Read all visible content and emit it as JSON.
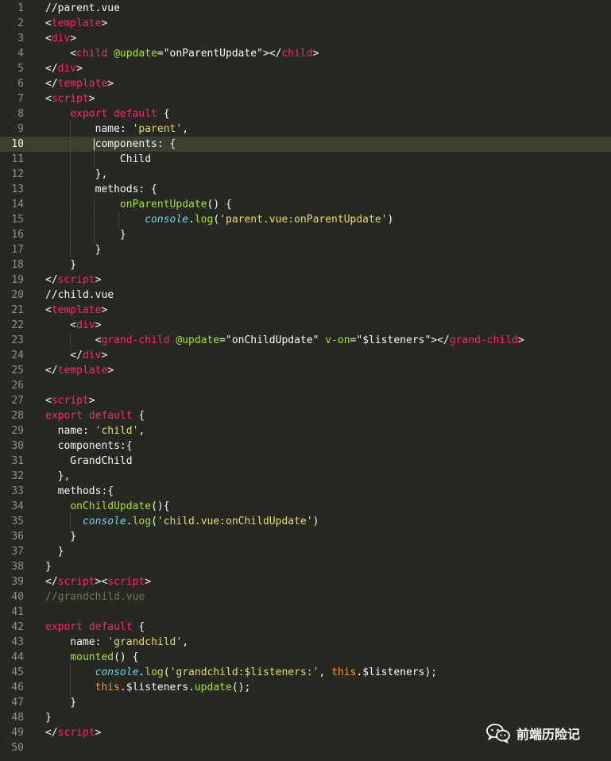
{
  "editor": {
    "active_line": 10,
    "lines": [
      {
        "n": "1",
        "t": [
          [
            "//parent.vue",
            "p"
          ]
        ]
      },
      {
        "n": "2",
        "t": [
          [
            "<",
            "p"
          ],
          [
            "template",
            "tag"
          ],
          [
            ">",
            "p"
          ]
        ]
      },
      {
        "n": "3",
        "t": [
          [
            "<",
            "p"
          ],
          [
            "div",
            "tag"
          ],
          [
            ">",
            "p"
          ]
        ]
      },
      {
        "n": "4",
        "t": [
          [
            "    <",
            "p"
          ],
          [
            "child",
            "tag"
          ],
          [
            " ",
            "p"
          ],
          [
            "@update",
            "attr"
          ],
          [
            "=",
            "p"
          ],
          [
            "\"onParentUpdate\"",
            "p"
          ],
          [
            "></",
            "p"
          ],
          [
            "child",
            "tag"
          ],
          [
            ">",
            "p"
          ]
        ]
      },
      {
        "n": "5",
        "t": [
          [
            "</",
            "p"
          ],
          [
            "div",
            "tag"
          ],
          [
            ">",
            "p"
          ]
        ]
      },
      {
        "n": "6",
        "t": [
          [
            "</",
            "p"
          ],
          [
            "template",
            "tag"
          ],
          [
            ">",
            "p"
          ]
        ]
      },
      {
        "n": "7",
        "t": [
          [
            "<",
            "p"
          ],
          [
            "script",
            "tag"
          ],
          [
            ">",
            "p"
          ]
        ]
      },
      {
        "n": "8",
        "t": [
          [
            "    ",
            "p"
          ],
          [
            "export default",
            "kw"
          ],
          [
            " {",
            "p"
          ]
        ]
      },
      {
        "n": "9",
        "t": [
          [
            "        name: ",
            "p"
          ],
          [
            "'parent'",
            "str"
          ],
          [
            ",",
            "p"
          ]
        ]
      },
      {
        "n": "10",
        "t": [
          [
            "        components: {",
            "p"
          ]
        ]
      },
      {
        "n": "11",
        "t": [
          [
            "            Child",
            "p"
          ]
        ]
      },
      {
        "n": "12",
        "t": [
          [
            "        },",
            "p"
          ]
        ]
      },
      {
        "n": "13",
        "t": [
          [
            "        methods: {",
            "p"
          ]
        ]
      },
      {
        "n": "14",
        "t": [
          [
            "            ",
            "p"
          ],
          [
            "onParentUpdate",
            "fn"
          ],
          [
            "() {",
            "p"
          ]
        ]
      },
      {
        "n": "15",
        "t": [
          [
            "                ",
            "p"
          ],
          [
            "console",
            "type"
          ],
          [
            ".",
            "p"
          ],
          [
            "log",
            "fn"
          ],
          [
            "(",
            "p"
          ],
          [
            "'parent.vue:onParentUpdate'",
            "str"
          ],
          [
            ")",
            "p"
          ]
        ]
      },
      {
        "n": "16",
        "t": [
          [
            "            }",
            "p"
          ]
        ]
      },
      {
        "n": "17",
        "t": [
          [
            "        }",
            "p"
          ]
        ]
      },
      {
        "n": "18",
        "t": [
          [
            "    }",
            "p"
          ]
        ]
      },
      {
        "n": "19",
        "t": [
          [
            "</",
            "p"
          ],
          [
            "script",
            "tag"
          ],
          [
            ">",
            "p"
          ]
        ]
      },
      {
        "n": "20",
        "t": [
          [
            "//child.vue",
            "p"
          ]
        ]
      },
      {
        "n": "21",
        "t": [
          [
            "<",
            "p"
          ],
          [
            "template",
            "tag"
          ],
          [
            ">",
            "p"
          ]
        ]
      },
      {
        "n": "22",
        "t": [
          [
            "    <",
            "p"
          ],
          [
            "div",
            "tag"
          ],
          [
            ">",
            "p"
          ]
        ]
      },
      {
        "n": "23",
        "t": [
          [
            "        <",
            "p"
          ],
          [
            "grand-child",
            "tag"
          ],
          [
            " ",
            "p"
          ],
          [
            "@update",
            "attr"
          ],
          [
            "=",
            "p"
          ],
          [
            "\"onChildUpdate\"",
            "p"
          ],
          [
            " ",
            "p"
          ],
          [
            "v-on",
            "attr"
          ],
          [
            "=",
            "p"
          ],
          [
            "\"$listeners\"",
            "p"
          ],
          [
            "></",
            "p"
          ],
          [
            "grand-child",
            "tag"
          ],
          [
            ">",
            "p"
          ]
        ]
      },
      {
        "n": "24",
        "t": [
          [
            "    </",
            "p"
          ],
          [
            "div",
            "tag"
          ],
          [
            ">",
            "p"
          ]
        ]
      },
      {
        "n": "25",
        "t": [
          [
            "</",
            "p"
          ],
          [
            "template",
            "tag"
          ],
          [
            ">",
            "p"
          ]
        ]
      },
      {
        "n": "26",
        "t": []
      },
      {
        "n": "27",
        "t": [
          [
            "<",
            "p"
          ],
          [
            "script",
            "tag"
          ],
          [
            ">",
            "p"
          ]
        ]
      },
      {
        "n": "28",
        "t": [
          [
            "export default",
            "kw"
          ],
          [
            " {",
            "p"
          ]
        ]
      },
      {
        "n": "29",
        "t": [
          [
            "  name: ",
            "p"
          ],
          [
            "'child'",
            "str"
          ],
          [
            ",",
            "p"
          ]
        ]
      },
      {
        "n": "30",
        "t": [
          [
            "  components:{",
            "p"
          ]
        ]
      },
      {
        "n": "31",
        "t": [
          [
            "    GrandChild",
            "p"
          ]
        ]
      },
      {
        "n": "32",
        "t": [
          [
            "  },",
            "p"
          ]
        ]
      },
      {
        "n": "33",
        "t": [
          [
            "  methods:{",
            "p"
          ]
        ]
      },
      {
        "n": "34",
        "t": [
          [
            "    ",
            "p"
          ],
          [
            "onChildUpdate",
            "fn"
          ],
          [
            "(){",
            "p"
          ]
        ]
      },
      {
        "n": "35",
        "t": [
          [
            "      ",
            "p"
          ],
          [
            "console",
            "type"
          ],
          [
            ".",
            "p"
          ],
          [
            "log",
            "fn"
          ],
          [
            "(",
            "p"
          ],
          [
            "'child.vue:onChildUpdate'",
            "str"
          ],
          [
            ")",
            "p"
          ]
        ]
      },
      {
        "n": "36",
        "t": [
          [
            "    }",
            "p"
          ]
        ]
      },
      {
        "n": "37",
        "t": [
          [
            "  }",
            "p"
          ]
        ]
      },
      {
        "n": "38",
        "t": [
          [
            "}",
            "p"
          ]
        ]
      },
      {
        "n": "39",
        "t": [
          [
            "</",
            "p"
          ],
          [
            "script",
            "tag"
          ],
          [
            "><",
            "p"
          ],
          [
            "script",
            "tag"
          ],
          [
            ">",
            "p"
          ]
        ]
      },
      {
        "n": "40",
        "t": [
          [
            "//grandchild.vue",
            "cm"
          ]
        ]
      },
      {
        "n": "41",
        "t": []
      },
      {
        "n": "42",
        "t": [
          [
            "export default",
            "kw"
          ],
          [
            " {",
            "p"
          ]
        ]
      },
      {
        "n": "43",
        "t": [
          [
            "    name: ",
            "p"
          ],
          [
            "'grandchild'",
            "str"
          ],
          [
            ",",
            "p"
          ]
        ]
      },
      {
        "n": "44",
        "t": [
          [
            "    ",
            "p"
          ],
          [
            "mounted",
            "fn"
          ],
          [
            "() {",
            "p"
          ]
        ]
      },
      {
        "n": "45",
        "t": [
          [
            "        ",
            "p"
          ],
          [
            "console",
            "type"
          ],
          [
            ".",
            "p"
          ],
          [
            "log",
            "fn"
          ],
          [
            "(",
            "p"
          ],
          [
            "'grandchild:$listeners:'",
            "str"
          ],
          [
            ", ",
            "p"
          ],
          [
            "this",
            "this"
          ],
          [
            ".$listeners);",
            "p"
          ]
        ]
      },
      {
        "n": "46",
        "t": [
          [
            "        ",
            "p"
          ],
          [
            "this",
            "this"
          ],
          [
            ".$listeners.",
            "p"
          ],
          [
            "update",
            "fn"
          ],
          [
            "();",
            "p"
          ]
        ]
      },
      {
        "n": "47",
        "t": [
          [
            "    }",
            "p"
          ]
        ]
      },
      {
        "n": "48",
        "t": [
          [
            "}",
            "p"
          ]
        ]
      },
      {
        "n": "49",
        "t": [
          [
            "</",
            "p"
          ],
          [
            "script",
            "tag"
          ],
          [
            ">",
            "p"
          ]
        ]
      },
      {
        "n": "50",
        "t": []
      }
    ]
  },
  "colors": {
    "background": "#272822",
    "tag": "#f92672",
    "attribute": "#a6e22e",
    "string": "#e6db74",
    "type": "#66d9ef",
    "this": "#fd971f",
    "comment": "#75715e"
  },
  "watermark": {
    "icon": "wechat-icon",
    "text": "前端历险记"
  }
}
